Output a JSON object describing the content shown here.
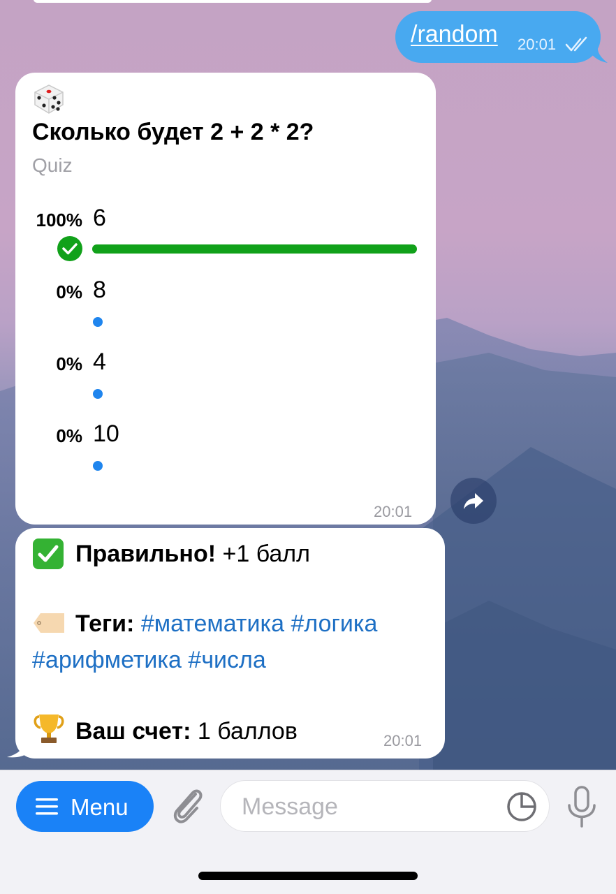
{
  "outgoing": {
    "command": "/random",
    "time": "20:01",
    "status_icon": "double-check-icon"
  },
  "poll": {
    "emoji": "game-die-icon",
    "question": "Сколько будет 2 + 2 * 2?",
    "type_label": "Quiz",
    "options": [
      {
        "percent": "100%",
        "text": "6",
        "correct": true,
        "fraction": 1.0
      },
      {
        "percent": "0%",
        "text": "8",
        "correct": false,
        "fraction": 0
      },
      {
        "percent": "0%",
        "text": "4",
        "correct": false,
        "fraction": 0
      },
      {
        "percent": "0%",
        "text": "10",
        "correct": false,
        "fraction": 0
      }
    ],
    "time": "20:01",
    "colors": {
      "correct_bar": "#11a11a",
      "dot": "#1f85ee"
    }
  },
  "result": {
    "line1_emoji": "check-mark-button-icon",
    "line1_bold": "Правильно!",
    "line1_rest": " +1 балл",
    "tags_emoji": "label-tag-icon",
    "tags_label": "Теги:",
    "tags": [
      "#математика",
      "#логика",
      "#арифметика",
      "#числа"
    ],
    "score_emoji": "trophy-icon",
    "score_label": "Ваш счет:",
    "score_value": " 1 баллов",
    "time": "20:01"
  },
  "composer": {
    "menu_label": "Menu",
    "placeholder": "Message",
    "accent": "#1a82f7"
  }
}
